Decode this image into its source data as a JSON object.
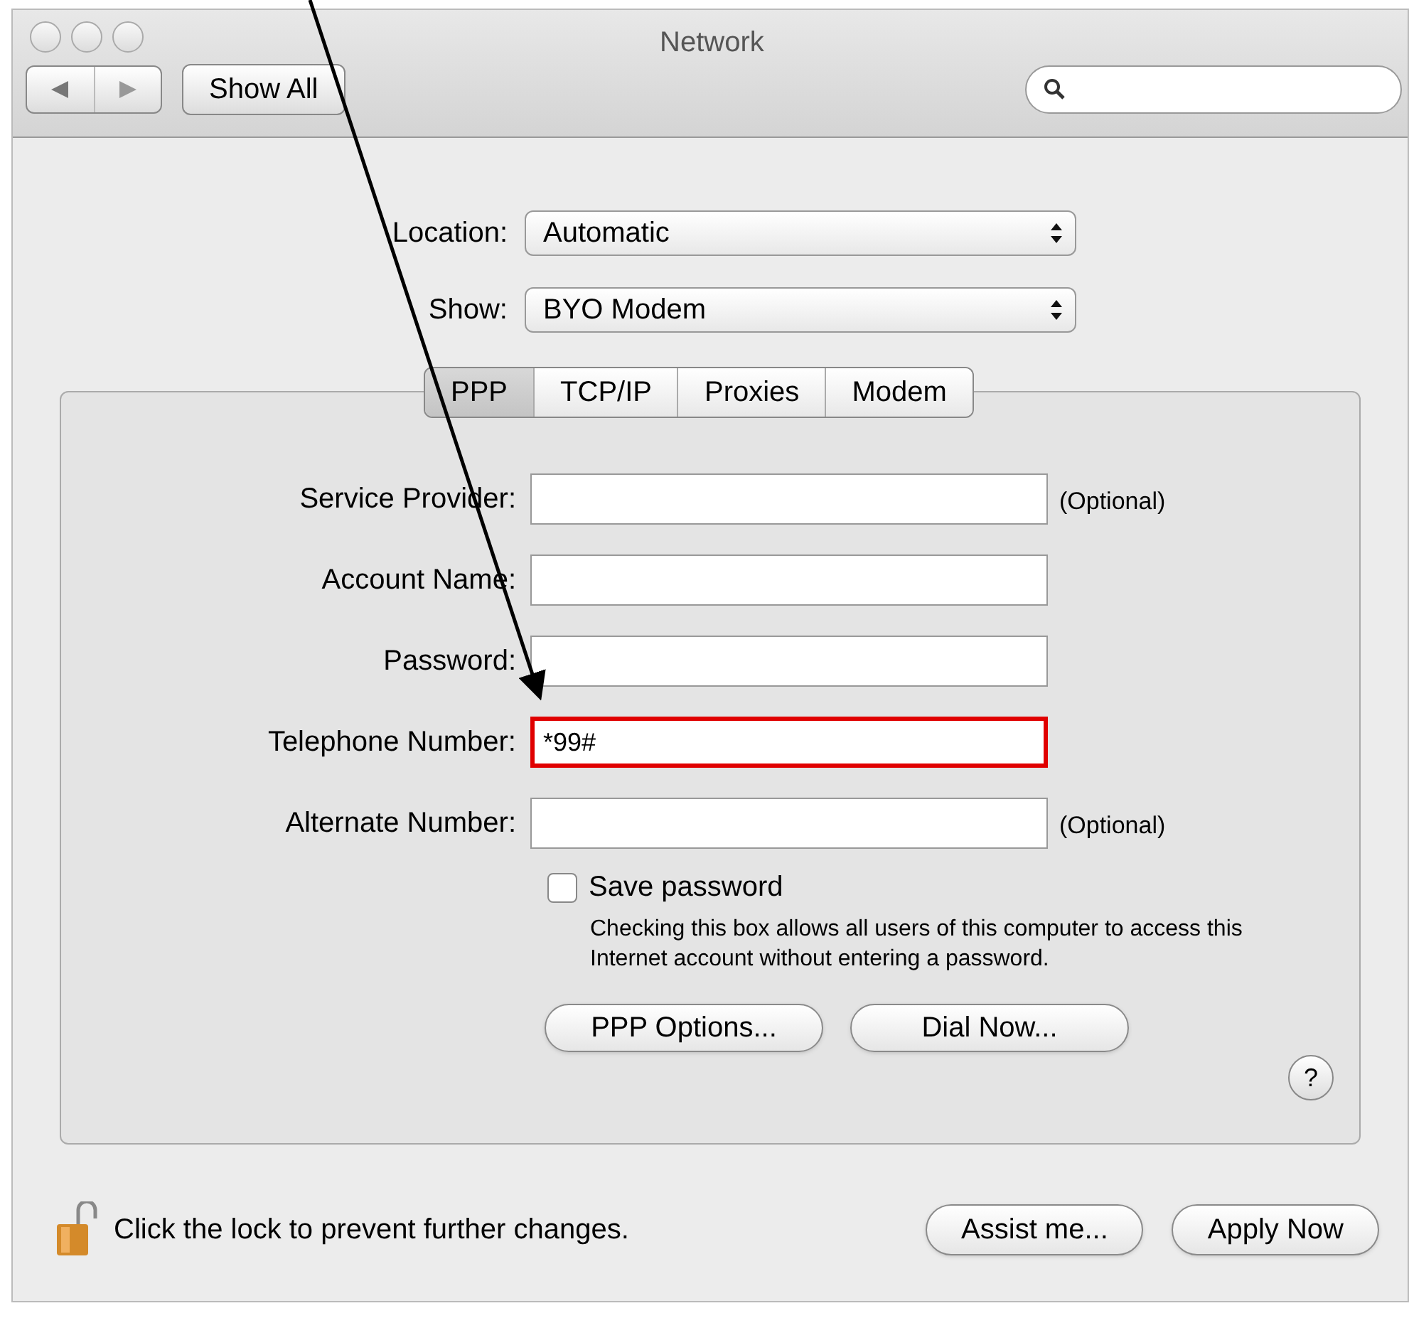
{
  "window": {
    "title": "Network"
  },
  "toolbar": {
    "show_all": "Show All"
  },
  "location": {
    "label": "Location:",
    "value": "Automatic"
  },
  "show": {
    "label": "Show:",
    "value": "BYO Modem"
  },
  "tabs": [
    {
      "label": "PPP",
      "selected": true
    },
    {
      "label": "TCP/IP",
      "selected": false
    },
    {
      "label": "Proxies",
      "selected": false
    },
    {
      "label": "Modem",
      "selected": false
    }
  ],
  "fields": [
    {
      "label": "Service Provider:",
      "note": "(Optional)",
      "highlighted": false
    },
    {
      "label": "Account Name:",
      "highlighted": false
    },
    {
      "label": "Password:",
      "highlighted": false
    },
    {
      "label": "Telephone Number:",
      "value": "*99#",
      "highlighted": true
    },
    {
      "label": "Alternate Number:",
      "note": "(Optional)",
      "highlighted": false
    }
  ],
  "save_password": {
    "label": "Save password",
    "checked": false,
    "hint": "Checking this box allows all users of this computer to access this Internet account without entering a password."
  },
  "panel_buttons": [
    "PPP Options...",
    "Dial Now..."
  ],
  "help": "?",
  "footer": {
    "lock_text": "Click the lock to prevent further changes.",
    "buttons": [
      "Assist me...",
      "Apply Now"
    ]
  }
}
